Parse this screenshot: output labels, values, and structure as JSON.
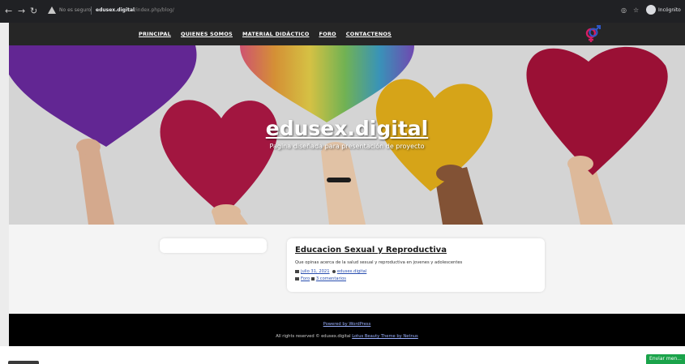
{
  "browser": {
    "security_label": "No es seguro",
    "url_domain": "edusex.digital",
    "url_path": "/index.php/blog/",
    "profile_label": "Incógnito"
  },
  "nav": {
    "items": [
      "PRINCIPAL",
      "QUIENES SOMOS",
      "MATERIAL DIDÁCTICO",
      "FORO",
      "CONTACTENOS"
    ]
  },
  "hero": {
    "title": "edusex.digital",
    "subtitle": "Pagina diseñada para presentación de proyecto"
  },
  "post": {
    "title": "Educacion Sexual y Reproductiva",
    "excerpt": "Que opinas acerca de la salud sexual y reproductiva en jovenes y adolescentes",
    "date": "julio 31, 2021",
    "author": "edusex.digital",
    "category": "Foro",
    "comments": "3 comentarios"
  },
  "footer": {
    "powered": "Powered by WordPress",
    "rights_prefix": "All rights reserved © edusex.digital",
    "theme_link": "Lotus Beauty Theme by Netnus"
  },
  "chat": {
    "button_label": "Enviar men..."
  },
  "colors": {
    "nav_bg": "#262626",
    "footer_bg": "#000000",
    "send_button": "#1aa34a"
  }
}
